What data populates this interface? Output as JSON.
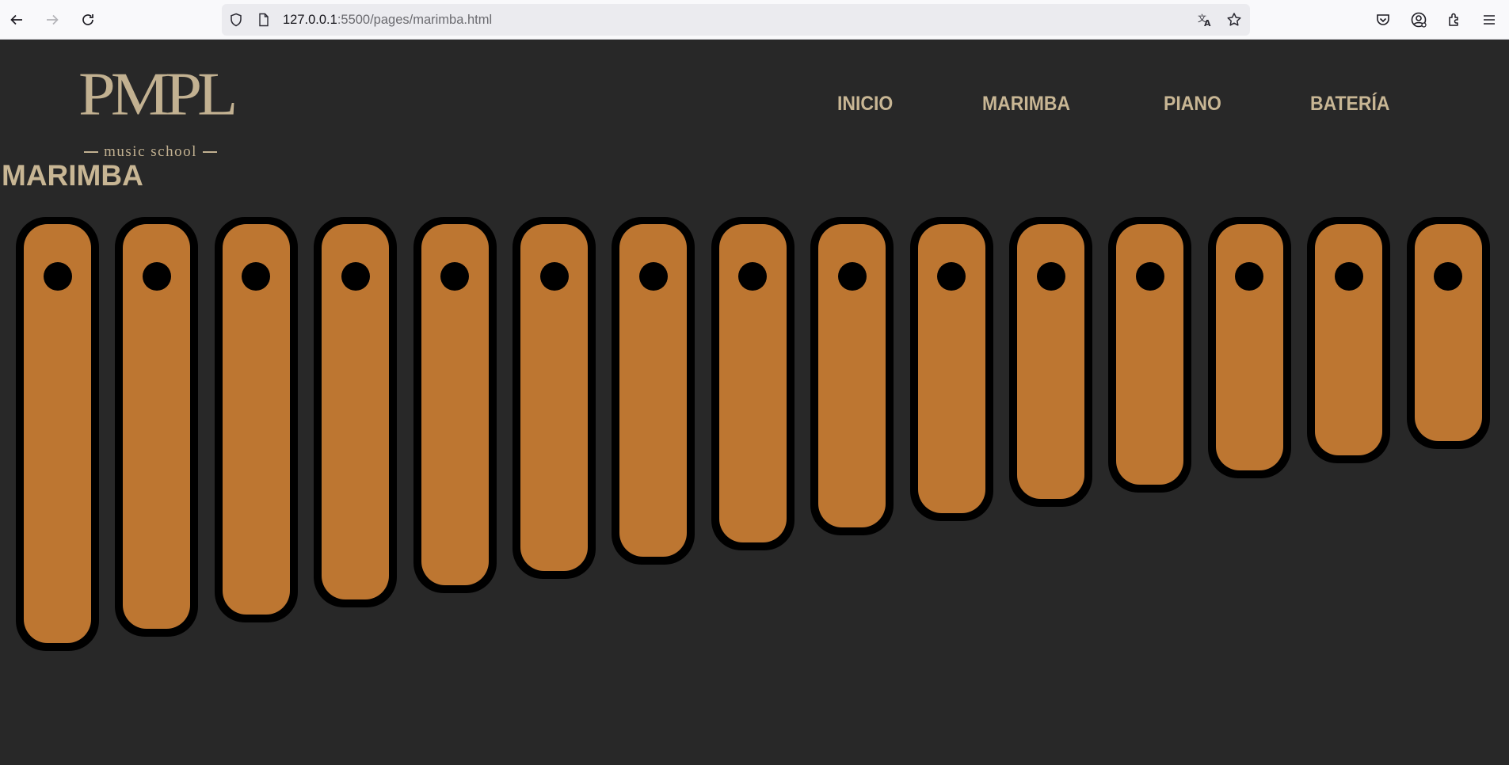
{
  "browser": {
    "url_host": "127.0.0.1",
    "url_rest": ":5500/pages/marimba.html",
    "icons": [
      "back-arrow-icon",
      "forward-arrow-icon",
      "reload-icon",
      "shield-icon",
      "page-icon",
      "translate-icon",
      "star-icon",
      "pocket-icon",
      "account-icon",
      "extensions-icon",
      "menu-icon"
    ]
  },
  "header": {
    "logo_main": "PMPL",
    "logo_sub": "music school",
    "nav": [
      "INICIO",
      "MARIMBA",
      "PIANO",
      "BATERÍA"
    ]
  },
  "main": {
    "title": "MARIMBA",
    "key_count": 15
  },
  "colors": {
    "background": "#282828",
    "accent_text": "#c8b694",
    "key_wood": "#bd7631",
    "key_border": "#000000"
  }
}
